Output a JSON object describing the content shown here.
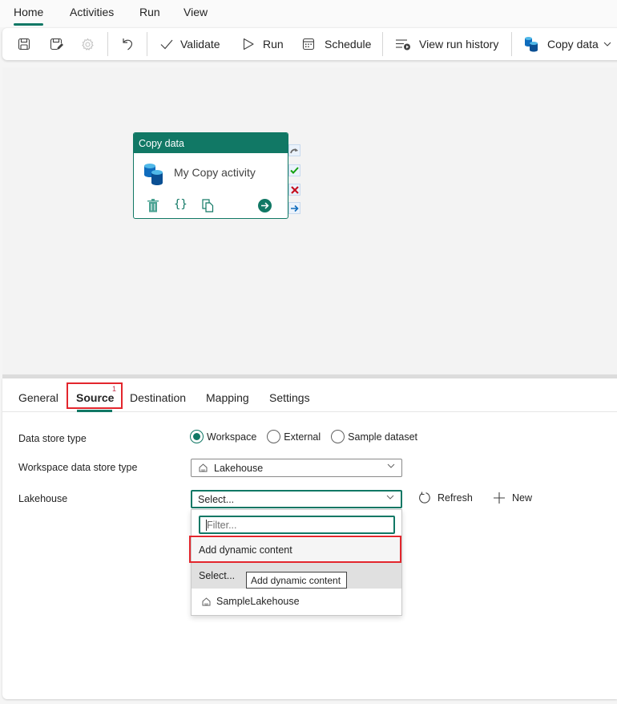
{
  "top_tabs": [
    {
      "label": "Home",
      "active": true
    },
    {
      "label": "Activities",
      "active": false
    },
    {
      "label": "Run",
      "active": false
    },
    {
      "label": "View",
      "active": false
    }
  ],
  "toolbar": {
    "save_icon": "save-icon",
    "save_as_icon": "save-as-icon",
    "settings_icon": "gear-icon",
    "undo_icon": "undo-icon",
    "validate_label": "Validate",
    "run_label": "Run",
    "schedule_label": "Schedule",
    "view_run_history_label": "View run history",
    "copy_data_label": "Copy data"
  },
  "canvas": {
    "activity": {
      "type_label": "Copy data",
      "name": "My Copy activity",
      "actions": [
        "delete-icon",
        "code-icon",
        "copy-icon",
        "go-icon"
      ],
      "side_outputs": [
        "skip-icon",
        "success-icon",
        "failure-icon",
        "completion-icon"
      ]
    }
  },
  "panel": {
    "tabs": [
      {
        "label": "General",
        "active": false
      },
      {
        "label": "Source",
        "active": true,
        "badge": "1"
      },
      {
        "label": "Destination",
        "active": false
      },
      {
        "label": "Mapping",
        "active": false
      },
      {
        "label": "Settings",
        "active": false
      }
    ],
    "fields": {
      "data_store_type": {
        "label": "Data store type",
        "options": [
          "Workspace",
          "External",
          "Sample dataset"
        ],
        "selected": "Workspace"
      },
      "workspace_data_store_type": {
        "label": "Workspace data store type",
        "value": "Lakehouse"
      },
      "lakehouse": {
        "label": "Lakehouse",
        "value": "Select...",
        "refresh_label": "Refresh",
        "new_label": "New"
      }
    },
    "dropdown": {
      "filter_placeholder": "Filter...",
      "items": [
        "Add dynamic content",
        "Select...",
        "SampleLakehouse"
      ],
      "tooltip": "Add dynamic content"
    }
  },
  "colors": {
    "accent": "#117865",
    "highlight": "#e3262d"
  }
}
